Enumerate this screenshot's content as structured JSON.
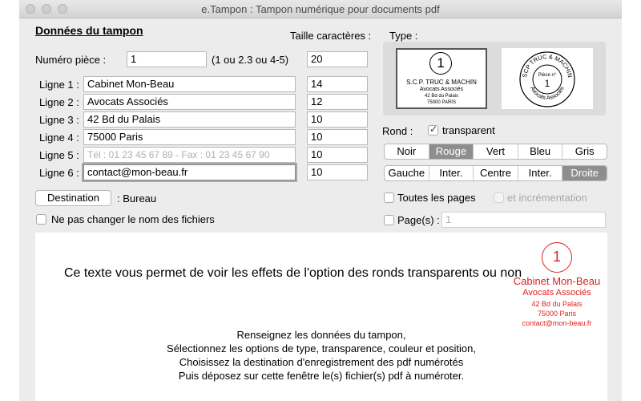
{
  "window": {
    "title": "e.Tampon : Tampon numérique pour documents pdf"
  },
  "form": {
    "section_title": "Données du tampon",
    "size_header": "Taille caractères :",
    "piece_label": "Numéro pièce :",
    "piece_value": "1",
    "piece_hint": "(1 ou 2.3 ou 4-5)",
    "piece_size": "20",
    "lines": [
      {
        "label": "Ligne 1 :",
        "value": "Cabinet Mon-Beau",
        "size": "14"
      },
      {
        "label": "Ligne 2 :",
        "value": "Avocats Associés",
        "size": "12"
      },
      {
        "label": "Ligne 3 :",
        "value": "42 Bd du Palais",
        "size": "10"
      },
      {
        "label": "Ligne 4 :",
        "value": "75000 Paris",
        "size": "10"
      },
      {
        "label": "Ligne 5 :",
        "placeholder": "Tél : 01 23 45 67 89 - Fax : 01 23 45 67 90",
        "size": "10"
      },
      {
        "label": "Ligne 6 :",
        "value": "contact@mon-beau.fr",
        "size": "10"
      }
    ],
    "destination_button": "Destination",
    "destination_value": ": Bureau",
    "keep_names_label": "Ne pas changer le nom des fichiers"
  },
  "type": {
    "label": "Type :",
    "rect_stamp": {
      "number": "1",
      "line1": "S.C.P. TRUC & MACHIN",
      "line2": "Avocats Associés",
      "line3": "42 Bd du Palais",
      "line4": "75000 PARIS"
    },
    "round_stamp": {
      "top_text": "SCP TRUC & MACHIN",
      "piece_label": "Pièce n°",
      "number": "1",
      "bottom_text": "Avocats Associés"
    }
  },
  "round": {
    "label": "Rond :",
    "transparent_label": "transparent",
    "transparent_checked": true
  },
  "colors": {
    "options": [
      "Noir",
      "Rouge",
      "Vert",
      "Bleu",
      "Gris"
    ],
    "selected": "Rouge",
    "stamp_color": "#e02020"
  },
  "positions": {
    "options": [
      "Gauche",
      "Inter.",
      "Centre",
      "Inter.",
      "Droite"
    ],
    "selected": "Droite"
  },
  "pages": {
    "all_pages_label": "Toutes les pages",
    "increment_label": "et incrémentation",
    "pages_label": "Page(s) :",
    "pages_placeholder": "1"
  },
  "preview": {
    "demo_text": "Ce texte vous permet de voir les effets de l'option des ronds transparents ou non",
    "stamp_number": "1",
    "stamp_lines": [
      "Cabinet Mon-Beau",
      "Avocats Associés",
      "42 Bd du Palais",
      "75000 Paris",
      "contact@mon-beau.fr"
    ],
    "instructions": [
      "Renseignez les données du tampon,",
      "Sélectionnez les options de type, transparence, couleur et position,",
      "Choisissez la destination d'enregistrement des pdf numérotés",
      "Puis déposez sur cette fenêtre le(s) fichier(s) pdf à numéroter."
    ]
  }
}
